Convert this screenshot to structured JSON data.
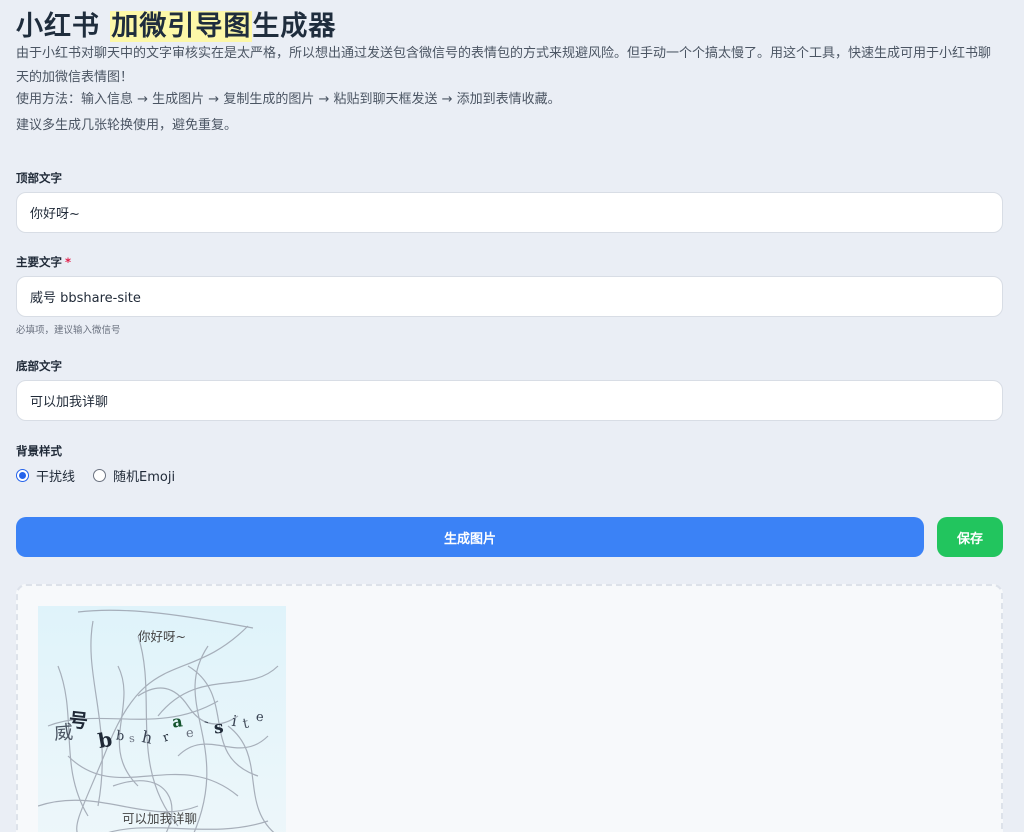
{
  "header": {
    "title_prefix": "小红书 ",
    "title_highlight": "加微引导图",
    "title_suffix": "生成器",
    "description": "由于小红书对聊天中的文字审核实在是太严格，所以想出通过发送包含微信号的表情包的方式来规避风险。但手动一个个搞太慢了。用这个工具，快速生成可用于小红书聊天的加微信表情图！",
    "usage": "使用方法：输入信息 → 生成图片 → 复制生成的图片 → 粘贴到聊天框发送 → 添加到表情收藏。",
    "tip": "建议多生成几张轮换使用，避免重复。"
  },
  "form": {
    "top_text": {
      "label": "顶部文字",
      "value": "你好呀~"
    },
    "main_text": {
      "label": "主要文字",
      "required_mark": "*",
      "value": "威号 bbshare-site",
      "hint": "必填项，建议输入微信号"
    },
    "bottom_text": {
      "label": "底部文字",
      "value": "可以加我详聊"
    },
    "background": {
      "label": "背景样式",
      "options": [
        {
          "label": "干扰线",
          "selected": true
        },
        {
          "label": "随机Emoji",
          "selected": false
        }
      ]
    }
  },
  "actions": {
    "generate_label": "生成图片",
    "save_label": "保存"
  },
  "preview": {
    "top_text": "你好呀~",
    "main_chars": [
      {
        "ch": "威",
        "color": "#4b5563"
      },
      {
        "ch": "号",
        "color": "#1f2937"
      },
      {
        "ch": "b",
        "color": "#1f2937"
      },
      {
        "ch": "b",
        "color": "#374151"
      },
      {
        "ch": "s",
        "color": "#6b7280"
      },
      {
        "ch": "h",
        "color": "#374151"
      },
      {
        "ch": "a",
        "color": "#14532d"
      },
      {
        "ch": "r",
        "color": "#1f2937"
      },
      {
        "ch": "e",
        "color": "#6b7280"
      },
      {
        "ch": "-",
        "color": "#374151"
      },
      {
        "ch": "s",
        "color": "#1f2937"
      },
      {
        "ch": "i",
        "color": "#374151"
      },
      {
        "ch": "t",
        "color": "#4b5563"
      },
      {
        "ch": "e",
        "color": "#374151"
      }
    ],
    "bottom_text": "可以加我详聊",
    "background_color": "#dff3fa",
    "line_color": "#9ca3af"
  },
  "colors": {
    "primary": "#3b82f6",
    "success": "#22c55e",
    "highlight": "#fdf8a8",
    "required": "#e11d48"
  }
}
